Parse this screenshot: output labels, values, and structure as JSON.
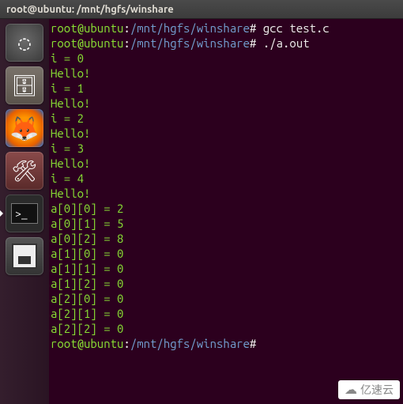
{
  "window": {
    "title": "root@ubuntu: /mnt/hgfs/winshare"
  },
  "launcher": {
    "items": [
      {
        "name": "dash-icon",
        "glyph": "◌"
      },
      {
        "name": "files-icon",
        "glyph": "🗄"
      },
      {
        "name": "firefox-icon",
        "glyph": "🦊"
      },
      {
        "name": "settings-icon",
        "glyph": "🛠"
      },
      {
        "name": "terminal-icon",
        "glyph": ">_"
      },
      {
        "name": "save-icon",
        "glyph": ""
      }
    ]
  },
  "prompt": {
    "user_host": "root@ubuntu",
    "sep1": ":",
    "path": "/mnt/hgfs/winshare",
    "sep2": "#"
  },
  "commands": {
    "c1": "gcc test.c",
    "c2": "./a.out"
  },
  "output": [
    "i = 0",
    "Hello!",
    "i = 1",
    "Hello!",
    "i = 2",
    "Hello!",
    "i = 3",
    "Hello!",
    "i = 4",
    "Hello!",
    "a[0][0] = 2",
    "a[0][1] = 5",
    "a[0][2] = 8",
    "a[1][0] = 0",
    "a[1][1] = 0",
    "a[1][2] = 0",
    "a[2][0] = 0",
    "a[2][1] = 0",
    "a[2][2] = 0"
  ],
  "watermark": {
    "text": "亿速云"
  }
}
